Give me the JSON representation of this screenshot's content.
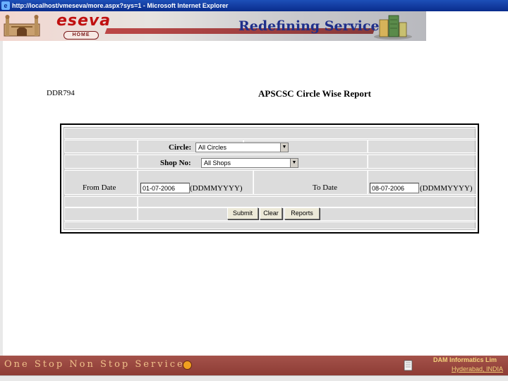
{
  "window": {
    "title": "http://localhost/vmeseva/more.aspx?sys=1 - Microsoft Internet Explorer"
  },
  "header": {
    "brand": "eseva",
    "home_label": "HOME",
    "tagline": "Redefining Service"
  },
  "report": {
    "code": "DDR794",
    "title": "APSCSC Circle Wise Report"
  },
  "form": {
    "circle_label": "Circle:",
    "circle_value": "All Circles",
    "shop_label": "Shop No:",
    "shop_value": "All Shops",
    "from_label": "From Date",
    "from_value": "01-07-2006",
    "from_format": "(DDMMYYYY)",
    "to_label": "To Date",
    "to_value": "08-07-2006",
    "to_format": "(DDMMYYYY)",
    "buttons": {
      "submit": "Submit",
      "clear": "Clear",
      "reports": "Reports"
    }
  },
  "footer": {
    "slogan": "One Stop Non Stop Service",
    "company": "DAM Informatics Lim",
    "city": "Hyderabad, INDIA"
  },
  "colors": {
    "footer_bg": "#9a4640",
    "footer_text": "#f0c18a",
    "tagline": "#1f2f8a",
    "brand": "#c01010"
  }
}
